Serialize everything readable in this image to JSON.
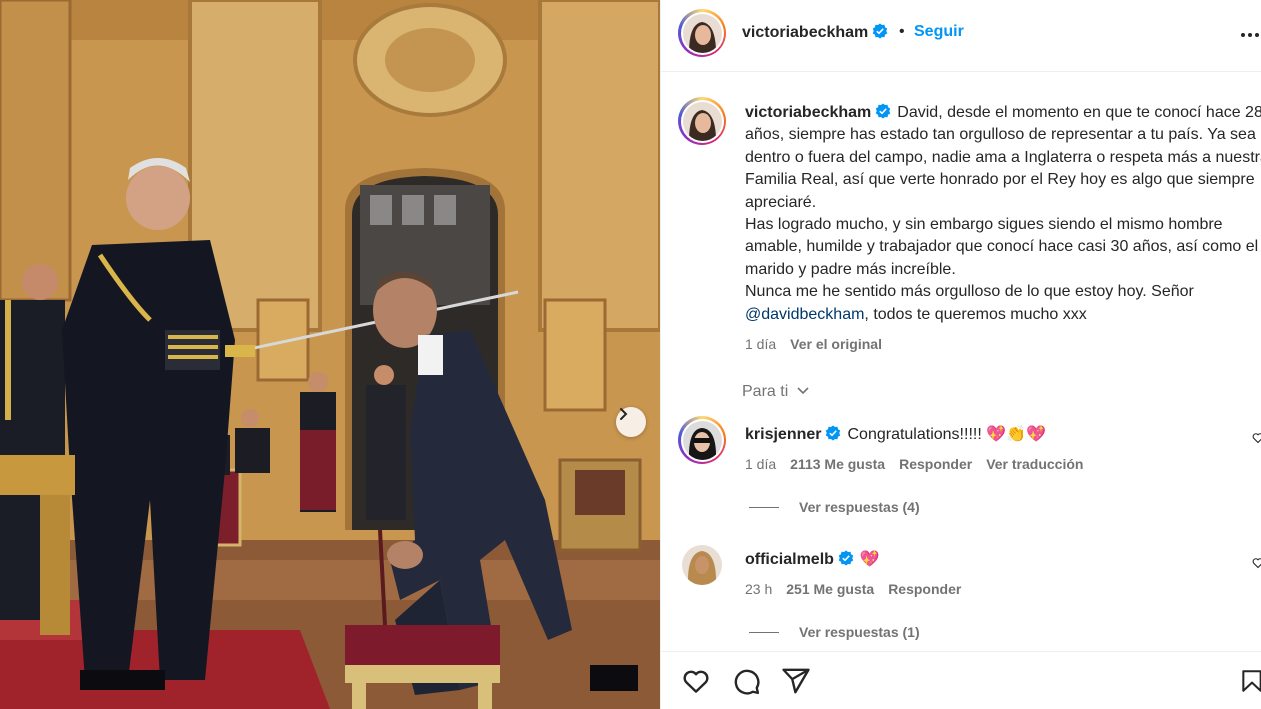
{
  "post": {
    "username": "victoriabeckham",
    "follow_label": "Seguir",
    "separator": "•",
    "more_label": "•••"
  },
  "caption": {
    "username": "victoriabeckham",
    "text_part1": "David, desde el momento en que te conocí hace 28 años, siempre has estado tan orgulloso de representar a tu país. Ya sea dentro o fuera del campo, nadie ama a Inglaterra o respeta más a nuestra Familia Real, así que verte honrado por el Rey hoy es algo que siempre apreciaré.\nHas logrado mucho, y sin embargo sigues siendo el mismo hombre amable, humilde y trabajador que conocí hace casi 30 años, así como el marido y padre más increíble.\nNunca me he sentido más orgulloso de lo que estoy hoy. Señor ",
    "mention": "@davidbeckham",
    "text_part2": ", todos te queremos mucho xxx",
    "time": "1 día",
    "see_original": "Ver el original"
  },
  "sort_label": "Para ti",
  "comments": [
    {
      "username": "krisjenner",
      "text": "Congratulations!!!!! ",
      "emojis": "💖👏💖",
      "time": "1 día",
      "likes": "2113 Me gusta",
      "reply": "Responder",
      "translate": "Ver traducción",
      "view_replies": "Ver respuestas (4)"
    },
    {
      "username": "officialmelb",
      "text": "",
      "emojis": "💖",
      "time": "23 h",
      "likes": "251 Me gusta",
      "reply": "Responder",
      "view_replies": "Ver respuestas (1)"
    }
  ],
  "icons": {
    "like": "heart-icon",
    "comment": "comment-icon",
    "share": "share-icon",
    "save": "bookmark-icon",
    "next": "chevron-right-icon",
    "verified": "verified-badge-icon"
  },
  "colors": {
    "link": "#0095f6",
    "mention": "#00376b",
    "secondary": "#737373",
    "verified": "#0095f6"
  }
}
